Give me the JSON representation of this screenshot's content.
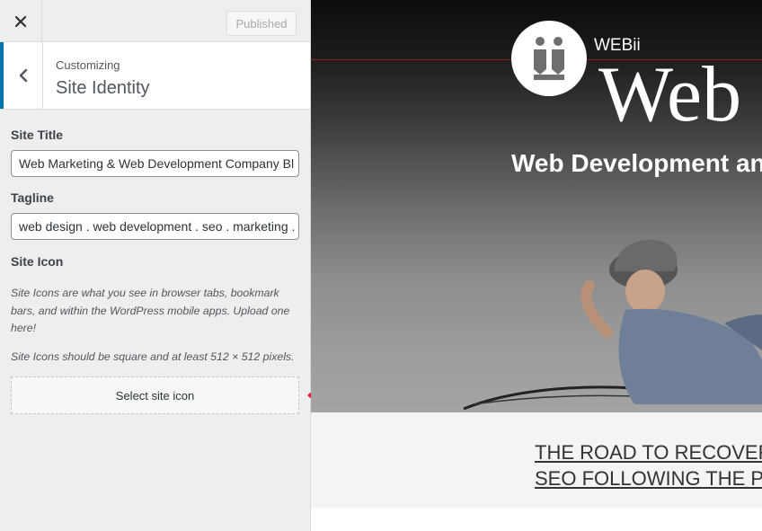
{
  "topbar": {
    "close_icon": "close-icon",
    "publish_label": "Published"
  },
  "section": {
    "back_icon": "chevron-left-icon",
    "breadcrumb": "Customizing",
    "title": "Site Identity"
  },
  "controls": {
    "site_title_label": "Site Title",
    "site_title_value": "Web Marketing & Web Development Company Bl",
    "tagline_label": "Tagline",
    "tagline_value": "web design . web development . seo . marketing .",
    "site_icon_label": "Site Icon",
    "site_icon_desc1": "Site Icons are what you see in browser tabs, bookmark bars, and within the WordPress mobile apps. Upload one here!",
    "site_icon_desc2": "Site Icons should be square and at least 512 × 512 pixels.",
    "select_icon_label": "Select site icon"
  },
  "annotation": {
    "arrow_icon": "arrow-left-icon",
    "arrow_color": "#e4141c"
  },
  "preview": {
    "brand_small": "WEBii",
    "brand_big": "Web I",
    "hero_tagline": "Web Development an",
    "post_title_line1": "THE ROAD TO RECOVER",
    "post_title_line2": "SEO FOLLOWING THE P"
  },
  "colors": {
    "accent": "#0073aa",
    "sidebar_bg": "#eeeeee"
  }
}
